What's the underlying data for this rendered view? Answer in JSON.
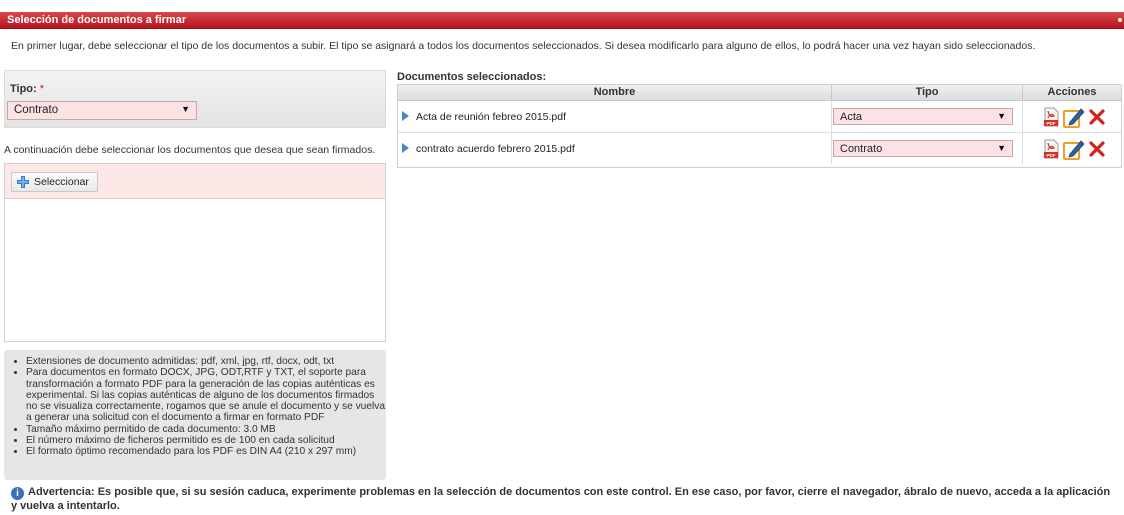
{
  "panel": {
    "title": "Selección de documentos a firmar"
  },
  "intro": "En primer lugar, debe seleccionar el tipo de los documentos a subir. El tipo se asignará a todos los documentos seleccionados. Si desea modificarlo para alguno de ellos, lo podrá hacer una vez hayan sido seleccionados.",
  "tipo": {
    "label": "Tipo:",
    "required_mark": "*",
    "selected": "Contrato"
  },
  "instructions": "A continuación debe seleccionar los documentos que desea que sean firmados.",
  "upload": {
    "button_label": "Seleccionar"
  },
  "notes": [
    "Extensiones de documento admitidas: pdf, xml, jpg, rtf, docx, odt, txt",
    "Para documentos en formato DOCX, JPG, ODT,RTF y TXT, el soporte para transformación a formato PDF para la generación de las copias auténticas es experimental. Si las copias auténticas de alguno de los documentos firmados no se visualiza correctamente, rogamos que se anule el documento y se vuelva a generar una solicitud con el documento a firmar en formato PDF",
    "Tamaño máximo permitido de cada documento: 3.0 MB",
    "El número máximo de ficheros permitido es de 100 en cada solicitud",
    "El formato óptimo recomendado para los PDF es DIN A4 (210 x 297 mm)"
  ],
  "documents": {
    "label": "Documentos seleccionados:",
    "columns": [
      "Nombre",
      "Tipo",
      "Acciones"
    ],
    "rows": [
      {
        "name": "Acta de reunión febreo 2015.pdf",
        "tipo": "Acta"
      },
      {
        "name": "contrato acuerdo febrero 2015.pdf",
        "tipo": "Contrato"
      }
    ]
  },
  "warning": "Advertencia: Es posible que, si su sesión caduca, experimente problemas en la selección de documentos con este control. En ese caso, por favor, cierre el navegador, ábralo de nuevo, acceda a la aplicación y vuelva a intentarlo.",
  "colors": {
    "title_bar": "#c0232a",
    "select_bg": "#fbe3e3",
    "upload_header": "#fde8e8",
    "expand_arrow": "#4a86c8",
    "delete": "#d42020"
  },
  "icons": [
    "plus-icon",
    "expand-arrow-icon",
    "pdf-icon",
    "edit-sign-icon",
    "delete-icon",
    "info-icon",
    "dropdown-arrow-icon"
  ]
}
